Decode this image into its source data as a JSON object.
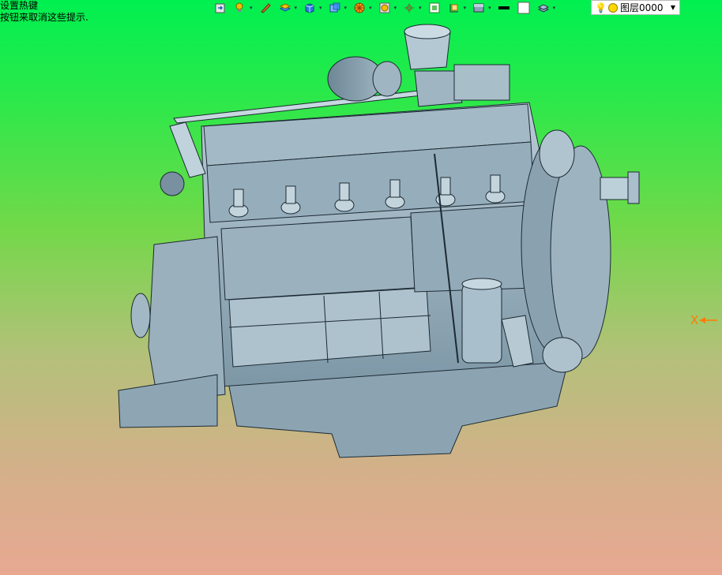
{
  "hint": {
    "line1": "设置热键",
    "line2": "按钮来取消这些提示."
  },
  "toolbar": {
    "items": [
      {
        "icon": "open-file-icon"
      },
      {
        "icon": "light-bulb-icon"
      },
      {
        "icon": "pen-icon"
      },
      {
        "icon": "layer-block-icon"
      },
      {
        "icon": "blue-box-icon"
      },
      {
        "icon": "view-cube-icon"
      },
      {
        "icon": "wheel-icon"
      },
      {
        "icon": "sphere-icon"
      },
      {
        "icon": "move-axis-icon"
      },
      {
        "icon": "fit-view-icon"
      },
      {
        "icon": "section-icon"
      },
      {
        "icon": "render-mode-icon"
      },
      {
        "icon": "line-color-icon"
      },
      {
        "icon": "fill-color-icon"
      },
      {
        "icon": "layer-stack-icon"
      }
    ],
    "line_color": "#000000",
    "fill_color": "#ffffff"
  },
  "layer_select": {
    "value": "图层0000"
  },
  "axis": {
    "label": "X",
    "color": "#ff7a00"
  }
}
